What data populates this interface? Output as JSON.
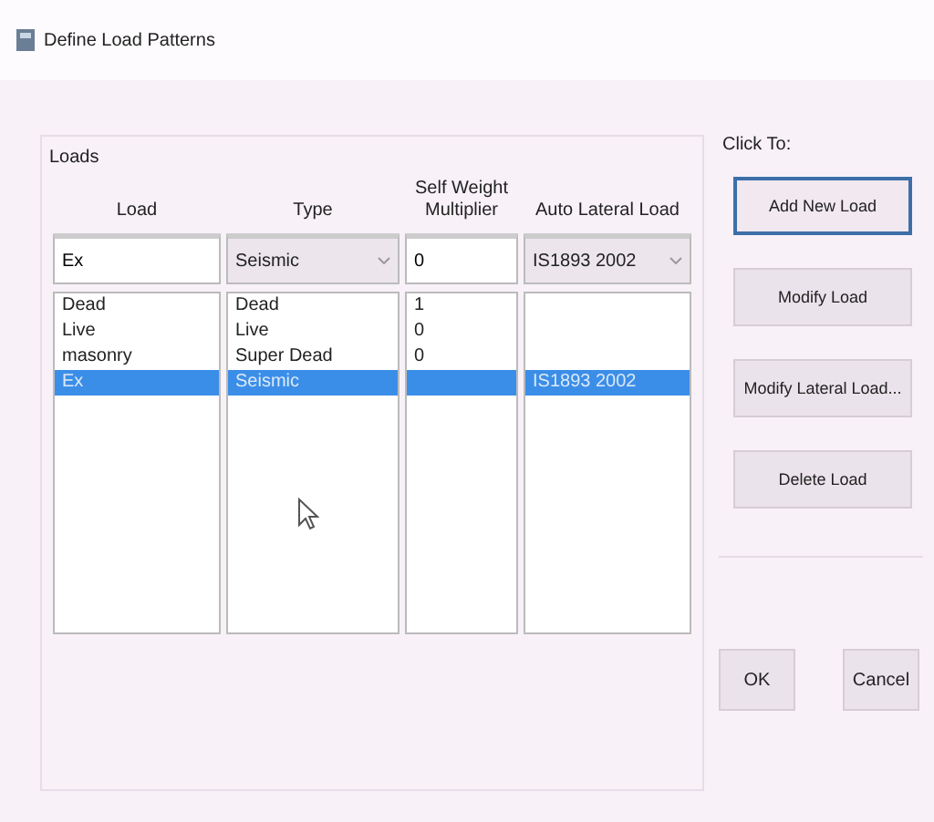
{
  "window": {
    "title": "Define Load Patterns"
  },
  "loads": {
    "title": "Loads",
    "columns": [
      "Load",
      "Type",
      "Self Weight Multiplier",
      "Auto Lateral Load"
    ],
    "input": {
      "load": "Ex",
      "type": "Seismic",
      "multiplier": "0",
      "auto_lateral": "IS1893 2002"
    },
    "rows": [
      {
        "load": "Dead",
        "type": "Dead",
        "multiplier": "1",
        "selected": false
      },
      {
        "load": "Live",
        "type": "Live",
        "multiplier": "0",
        "selected": false
      },
      {
        "load": "masonry",
        "type": "Super Dead",
        "multiplier": "0",
        "selected": false
      },
      {
        "load": "Ex",
        "type": "Seismic",
        "auto_lateral": "IS1893 2002",
        "selected": true
      }
    ]
  },
  "click_to": {
    "title": "Click To:",
    "buttons": [
      {
        "label": "Add New Load",
        "default": true
      },
      {
        "label": "Modify Load",
        "default": false
      },
      {
        "label": "Modify Lateral Load...",
        "default": false
      },
      {
        "label": "Delete Load",
        "default": false
      }
    ]
  },
  "footer_buttons": [
    "OK",
    "Cancel"
  ]
}
